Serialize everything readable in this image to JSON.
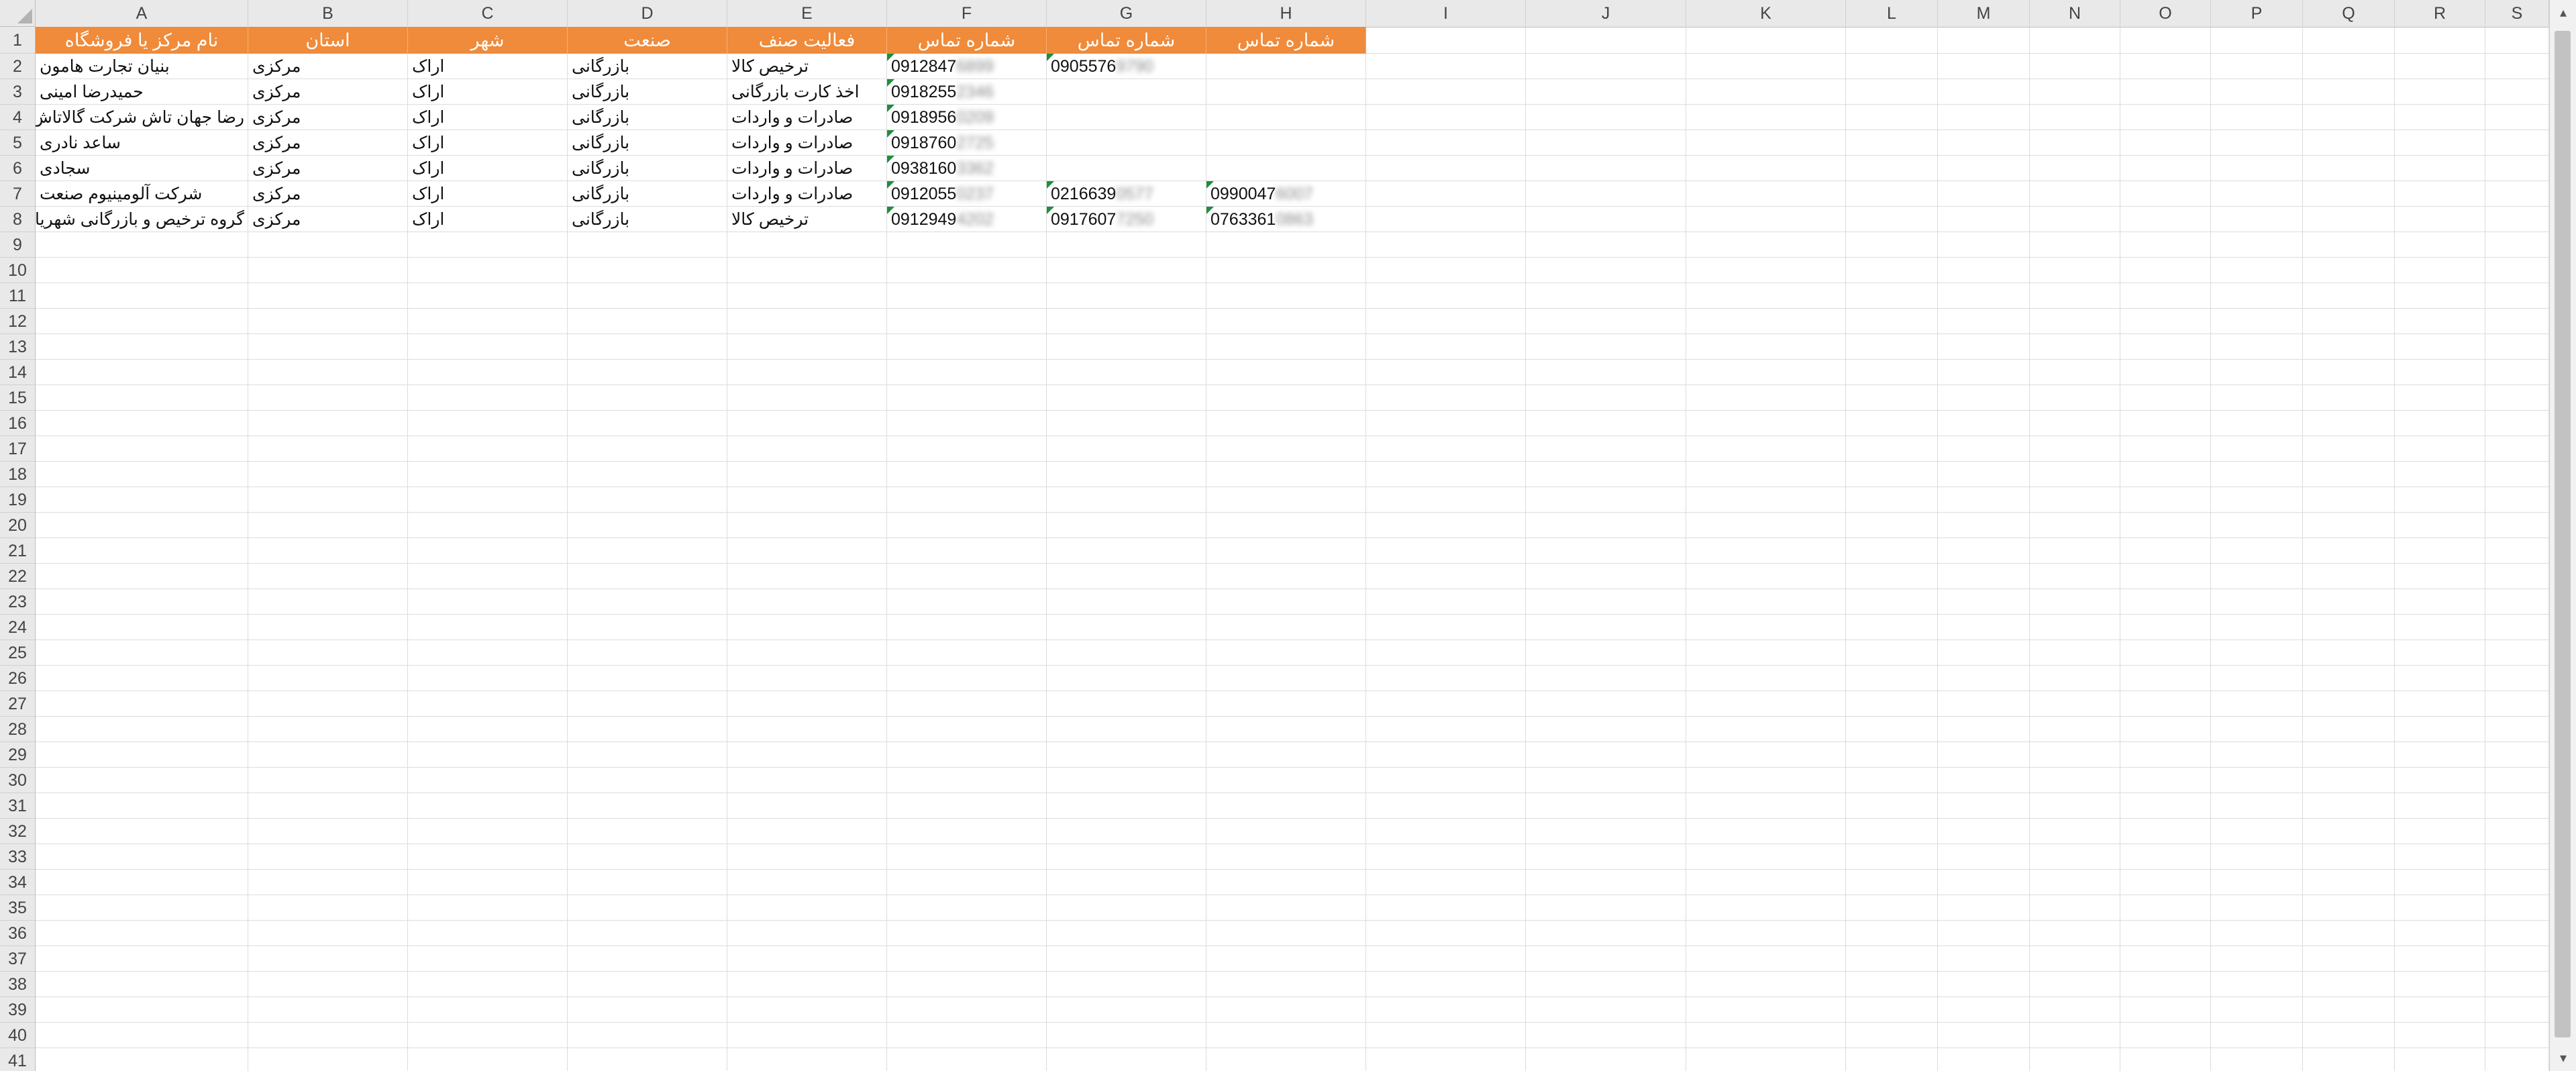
{
  "columns": [
    "A",
    "B",
    "C",
    "D",
    "E",
    "F",
    "G",
    "H",
    "I",
    "J",
    "K",
    "L",
    "M",
    "N",
    "O",
    "P",
    "Q",
    "R",
    "S"
  ],
  "header_row": [
    "نام مرکز یا فروشگاه",
    "استان",
    "شهر",
    "صنعت",
    "فعالیت صنف",
    "شماره تماس",
    "شماره تماس",
    "شماره تماس"
  ],
  "rows": [
    {
      "name": "بنیان تجارت هامون",
      "province": "مرکزی",
      "city": "اراک",
      "industry": "بازرگانی",
      "activity": "ترخیص کالا",
      "phone1": {
        "visible": "0912847",
        "hidden": "6899"
      },
      "phone2": {
        "visible": "0905576",
        "hidden": "9790"
      },
      "phone3": null
    },
    {
      "name": "حمیدرضا امینی",
      "province": "مرکزی",
      "city": "اراک",
      "industry": "بازرگانی",
      "activity": "اخذ کارت بازرگانی",
      "phone1": {
        "visible": "0918255",
        "hidden": "2346"
      },
      "phone2": null,
      "phone3": null
    },
    {
      "name": "رضا جهان تاش شرکت گالاتاش",
      "province": "مرکزی",
      "city": "اراک",
      "industry": "بازرگانی",
      "activity": "صادرات و واردات",
      "phone1": {
        "visible": "0918956",
        "hidden": "0209"
      },
      "phone2": null,
      "phone3": null
    },
    {
      "name": "ساعد نادری",
      "province": "مرکزی",
      "city": "اراک",
      "industry": "بازرگانی",
      "activity": "صادرات و واردات",
      "phone1": {
        "visible": "0918760",
        "hidden": "2725"
      },
      "phone2": null,
      "phone3": null
    },
    {
      "name": "سجادی",
      "province": "مرکزی",
      "city": "اراک",
      "industry": "بازرگانی",
      "activity": "صادرات و واردات",
      "phone1": {
        "visible": "0938160",
        "hidden": "3362"
      },
      "phone2": null,
      "phone3": null
    },
    {
      "name": "شرکت آلومینیوم صنعت",
      "province": "مرکزی",
      "city": "اراک",
      "industry": "بازرگانی",
      "activity": "صادرات و واردات",
      "phone1": {
        "visible": "0912055",
        "hidden": "0237"
      },
      "phone2": {
        "visible": "0216639",
        "hidden": "0577"
      },
      "phone3": {
        "visible": "0990047",
        "hidden": "6007"
      }
    },
    {
      "name": "گروه ترخیص و بازرگانی شهریاری",
      "province": "مرکزی",
      "city": "اراک",
      "industry": "بازرگانی",
      "activity": "ترخیص کالا",
      "phone1": {
        "visible": "0912949",
        "hidden": "4202"
      },
      "phone2": {
        "visible": "0917607",
        "hidden": "7250"
      },
      "phone3": {
        "visible": "0763361",
        "hidden": "0863"
      }
    }
  ],
  "row_numbers": [
    "1",
    "2",
    "3",
    "4",
    "5",
    "6",
    "7",
    "8",
    "9",
    "10",
    "11",
    "12",
    "13",
    "14",
    "15",
    "16",
    "17",
    "18",
    "19",
    "20",
    "21",
    "22",
    "23",
    "24",
    "25",
    "26",
    "27",
    "28",
    "29",
    "30",
    "31",
    "32",
    "33",
    "34",
    "35",
    "36",
    "37",
    "38",
    "39",
    "40",
    "41"
  ],
  "colors": {
    "header_fill": "#ef8b3a",
    "header_text": "#ffffff",
    "gridline": "#dcdcdc",
    "error_flag": "#1e8e3e"
  },
  "icons": {
    "scroll_up": "triangle-up-icon",
    "scroll_down": "triangle-down-icon",
    "select_all": "select-all-triangle-icon"
  }
}
